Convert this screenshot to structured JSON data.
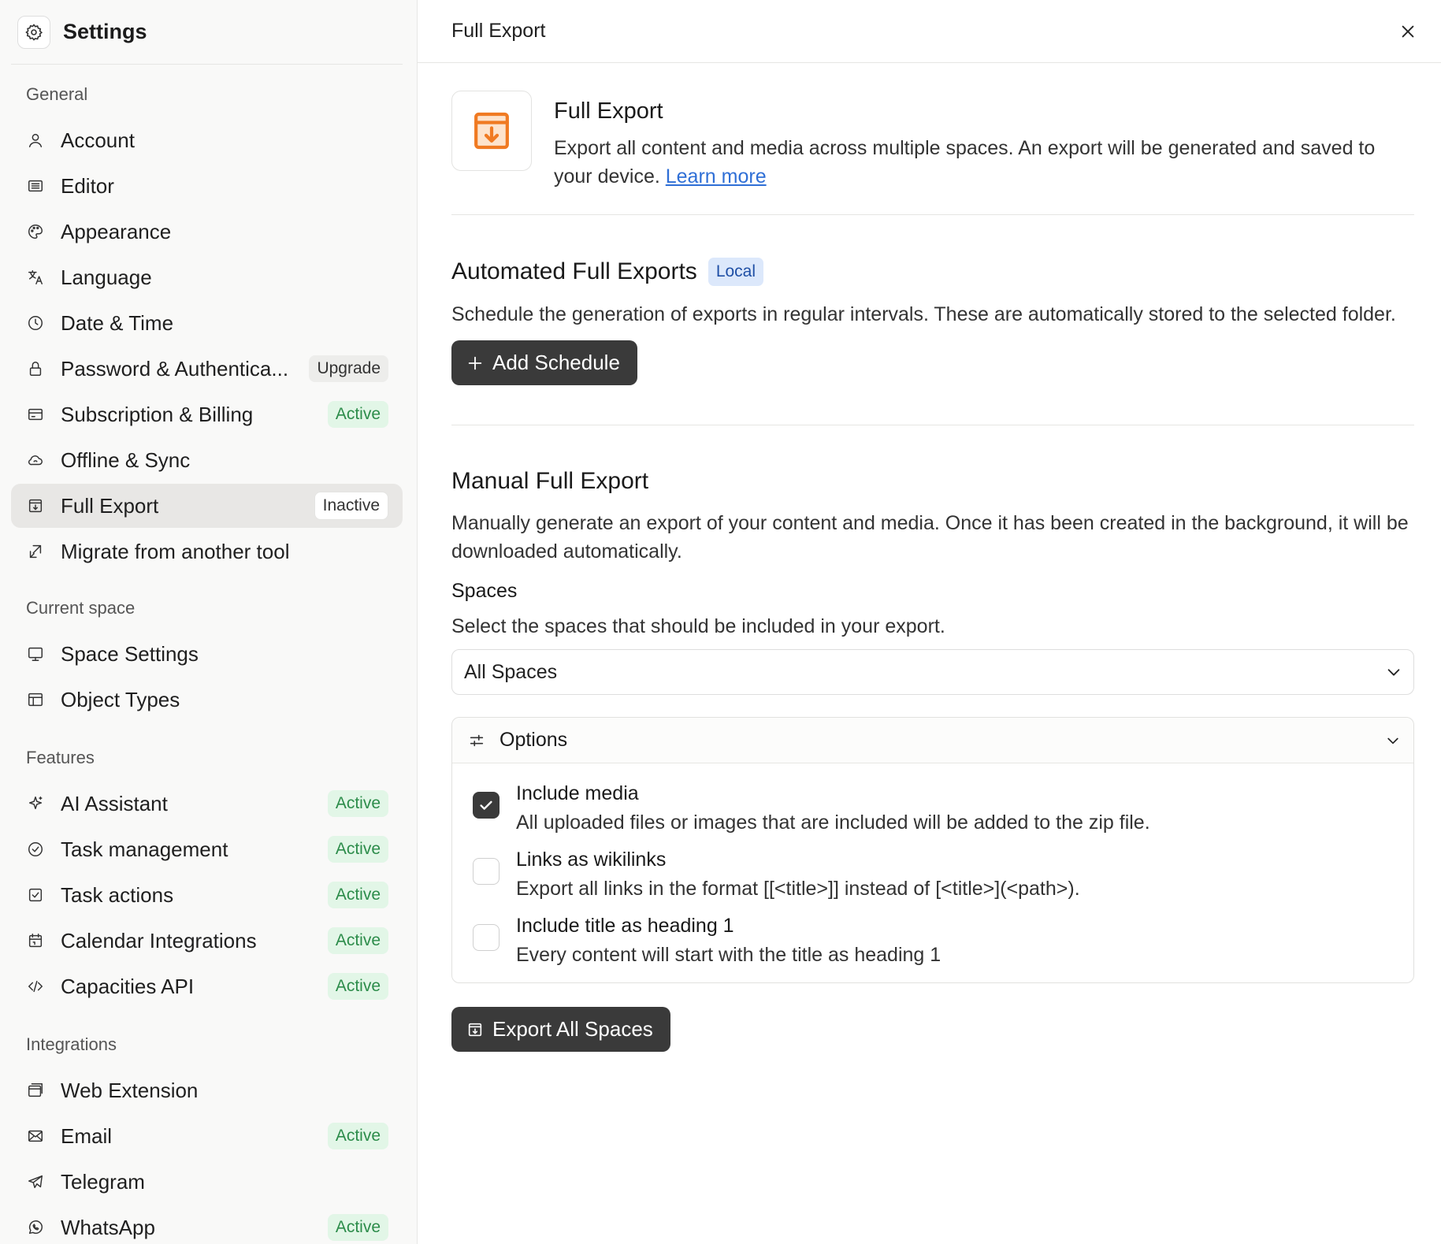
{
  "sidebar": {
    "title": "Settings",
    "sections": {
      "general": "General",
      "current_space": "Current space",
      "features": "Features",
      "integrations": "Integrations"
    },
    "general_items": [
      {
        "label": "Account",
        "icon": "user-icon",
        "badge": ""
      },
      {
        "label": "Editor",
        "icon": "keyboard-icon",
        "badge": ""
      },
      {
        "label": "Appearance",
        "icon": "palette-icon",
        "badge": ""
      },
      {
        "label": "Language",
        "icon": "translate-icon",
        "badge": ""
      },
      {
        "label": "Date & Time",
        "icon": "clock-icon",
        "badge": ""
      },
      {
        "label": "Password & Authentica...",
        "icon": "lock-icon",
        "badge": "Upgrade"
      },
      {
        "label": "Subscription & Billing",
        "icon": "credit-card-icon",
        "badge": "Active"
      },
      {
        "label": "Offline & Sync",
        "icon": "cloud-icon",
        "badge": ""
      },
      {
        "label": "Full Export",
        "icon": "archive-icon",
        "badge": "Inactive"
      },
      {
        "label": "Migrate from another tool",
        "icon": "import-icon",
        "badge": ""
      }
    ],
    "space_items": [
      {
        "label": "Space Settings",
        "icon": "monitor-icon"
      },
      {
        "label": "Object Types",
        "icon": "table-icon"
      }
    ],
    "feature_items": [
      {
        "label": "AI Assistant",
        "icon": "sparkle-icon",
        "badge": "Active"
      },
      {
        "label": "Task management",
        "icon": "check-circle-icon",
        "badge": "Active"
      },
      {
        "label": "Task actions",
        "icon": "check-square-icon",
        "badge": "Active"
      },
      {
        "label": "Calendar Integrations",
        "icon": "calendar-icon",
        "badge": "Active"
      },
      {
        "label": "Capacities API",
        "icon": "code-icon",
        "badge": "Active"
      }
    ],
    "integration_items": [
      {
        "label": "Web Extension",
        "icon": "browser-icon",
        "badge": ""
      },
      {
        "label": "Email",
        "icon": "mail-icon",
        "badge": "Active"
      },
      {
        "label": "Telegram",
        "icon": "send-icon",
        "badge": ""
      },
      {
        "label": "WhatsApp",
        "icon": "whatsapp-icon",
        "badge": "Active"
      }
    ]
  },
  "main": {
    "header_title": "Full Export",
    "hero": {
      "title": "Full Export",
      "desc": "Export all content and media across multiple spaces. An export will be generated and saved to your device.",
      "link": "Learn more"
    },
    "automated": {
      "title": "Automated Full Exports",
      "tag": "Local",
      "desc": "Schedule the generation of exports in regular intervals. These are automatically stored to the selected folder.",
      "button": "Add Schedule"
    },
    "manual": {
      "title": "Manual Full Export",
      "desc": "Manually generate an export of your content and media. Once it has been created in the background, it will be downloaded automatically.",
      "spaces_label": "Spaces",
      "spaces_help": "Select the spaces that should be included in your export.",
      "spaces_value": "All Spaces",
      "options_title": "Options",
      "options": [
        {
          "title": "Include media",
          "desc": "All uploaded files or images that are included will be added to the zip file.",
          "checked": true
        },
        {
          "title": "Links as wikilinks",
          "desc": "Export all links in the format [[<title>]] instead of [<title>](<path>).",
          "checked": false
        },
        {
          "title": "Include title as heading 1",
          "desc": "Every content will start with the title as heading 1",
          "checked": false
        }
      ],
      "export_button": "Export All Spaces"
    }
  },
  "colors": {
    "accent_orange": "#f07a22",
    "active_badge_bg": "#e2f6e7",
    "active_badge_text": "#2c8c4a",
    "local_tag_bg": "#dce8fb",
    "button_dark": "#3a3a3a"
  }
}
